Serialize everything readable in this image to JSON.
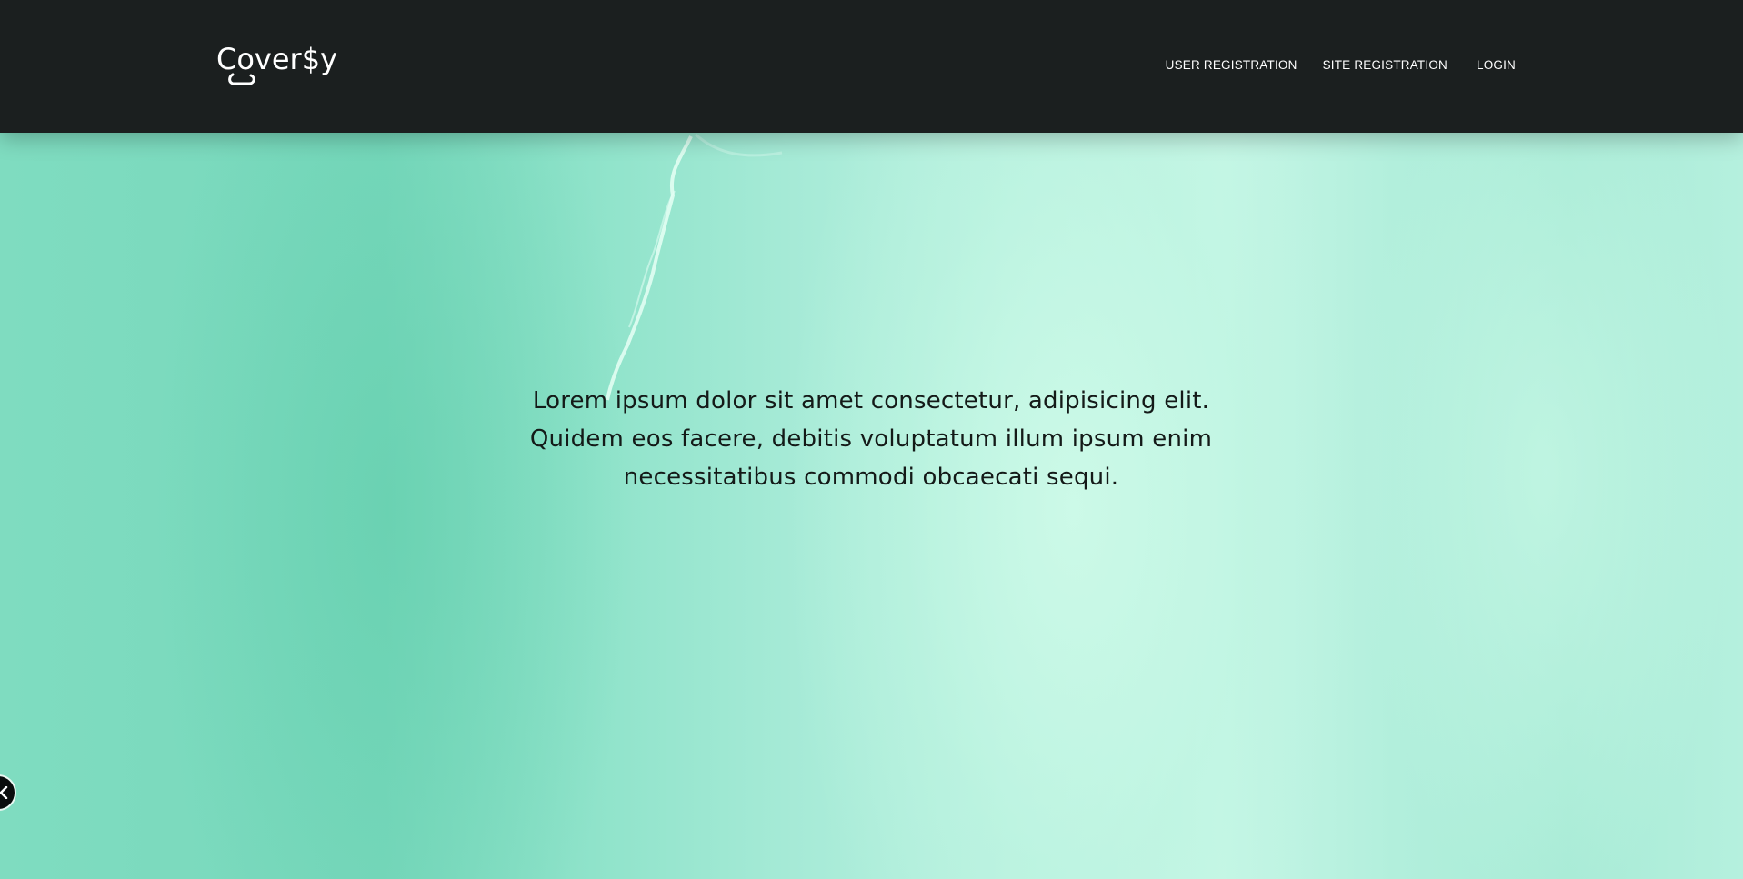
{
  "app": {
    "logo_text": "Cover$y"
  },
  "nav": {
    "items": [
      {
        "label": "USER REGISTRATION"
      },
      {
        "label": "SITE REGISTRATION"
      },
      {
        "label": "LOGIN"
      }
    ]
  },
  "hero": {
    "lines": [
      "Lorem ipsum dolor sit amet consectetur, adipisicing elit.",
      "Quidem eos facere, debitis voluptatum illum ipsum enim",
      "necessitatibus commodi obcaecati sequi."
    ]
  },
  "controls": {
    "scroll_button_icon": "chevron-left-icon"
  },
  "colors": {
    "navbar_bg": "#1b1f1f",
    "hero_base": "#86e0c6",
    "text_dark": "#141a18",
    "nav_text": "#ffffff"
  }
}
